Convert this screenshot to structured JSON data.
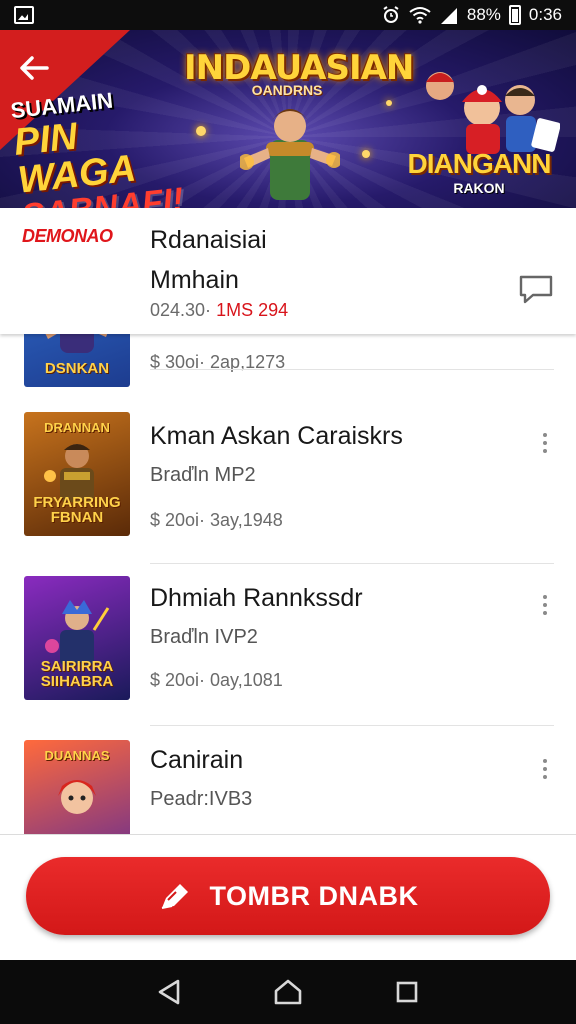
{
  "status_bar": {
    "battery_percent": "88%",
    "time": "0:36"
  },
  "banner": {
    "promo_line1": "SUAMAIN",
    "promo_line2": "PIN WAGA",
    "promo_line3": "SABNAFI!",
    "title": "INDAUASIAN",
    "subtitle": "OANDRNS",
    "right_title": "DIANGANN",
    "right_subtitle": "RAKON"
  },
  "sticky_item": {
    "brand": "DEMONAO",
    "title_line1": "Rdanaisiai",
    "title_line2": "Mmhain",
    "price_prefix": "024.30·",
    "price_highlight": "1MS 294"
  },
  "items": [
    {
      "thumb_caption": "DSNKAN",
      "thumb_caption_top": "",
      "title": "",
      "subtitle": "",
      "meta": "$ 30oi· 2ap,1273",
      "colors": [
        "#1d3c8f",
        "#2f69c8"
      ]
    },
    {
      "thumb_caption": "FRYARRING FBNAN",
      "thumb_caption_top": "DRANNAN",
      "title": "Kman Askan Caraiskrs",
      "subtitle": "Braďln MP2",
      "meta": "$ 20oi· 3ay,1948",
      "colors": [
        "#5a2a08",
        "#c7731d"
      ]
    },
    {
      "thumb_caption": "SAIRIRRA SIIHABRA",
      "thumb_caption_top": "",
      "title": "Dhmiah Rannkssdr",
      "subtitle": "Braďln IVP2",
      "meta": "$ 20oi· 0ay,1081",
      "colors": [
        "#1a1a5a",
        "#8a2bbf"
      ]
    },
    {
      "thumb_caption": "",
      "thumb_caption_top": "DUANNAS",
      "title": "Canirain",
      "subtitle": "Peadr:IVB3",
      "meta": "",
      "colors": [
        "#6b2f8e",
        "#ff6a3c"
      ]
    }
  ],
  "cta": {
    "label": "TOMBR DNABK"
  },
  "accent_color": "#d31818"
}
